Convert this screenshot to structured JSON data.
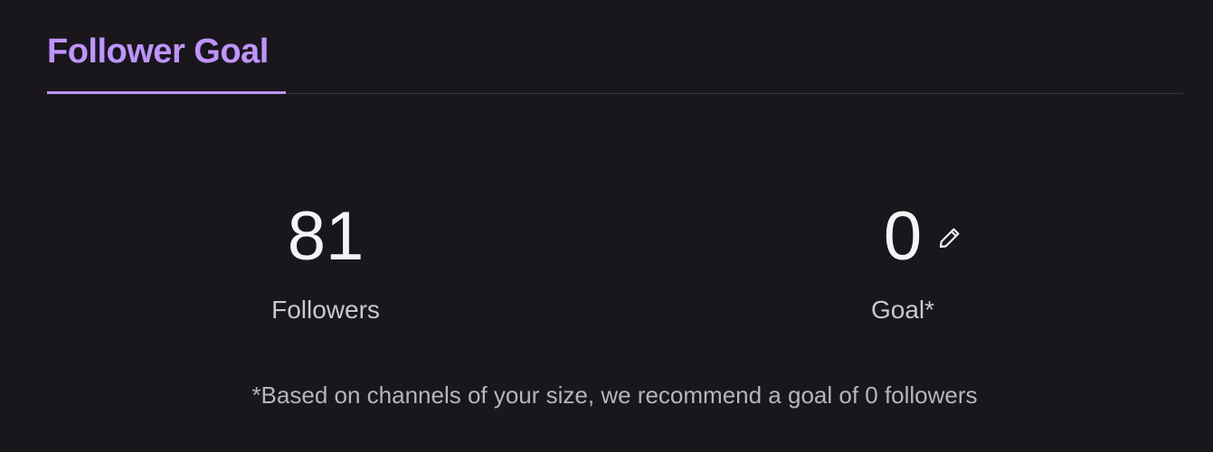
{
  "tabs": [
    {
      "label": "Follower Goal",
      "active": true
    }
  ],
  "stats": {
    "followers": {
      "value": "81",
      "label": "Followers"
    },
    "goal": {
      "value": "0",
      "label": "Goal*",
      "edit_icon": "pencil-icon"
    }
  },
  "footnote": "*Based on channels of your size, we recommend a goal of 0 followers",
  "colors": {
    "background": "#19171c",
    "accent": "#bf94ff",
    "divider": "#35343a",
    "text_primary": "#f4f4f6",
    "text_secondary": "#c9c8cd"
  }
}
